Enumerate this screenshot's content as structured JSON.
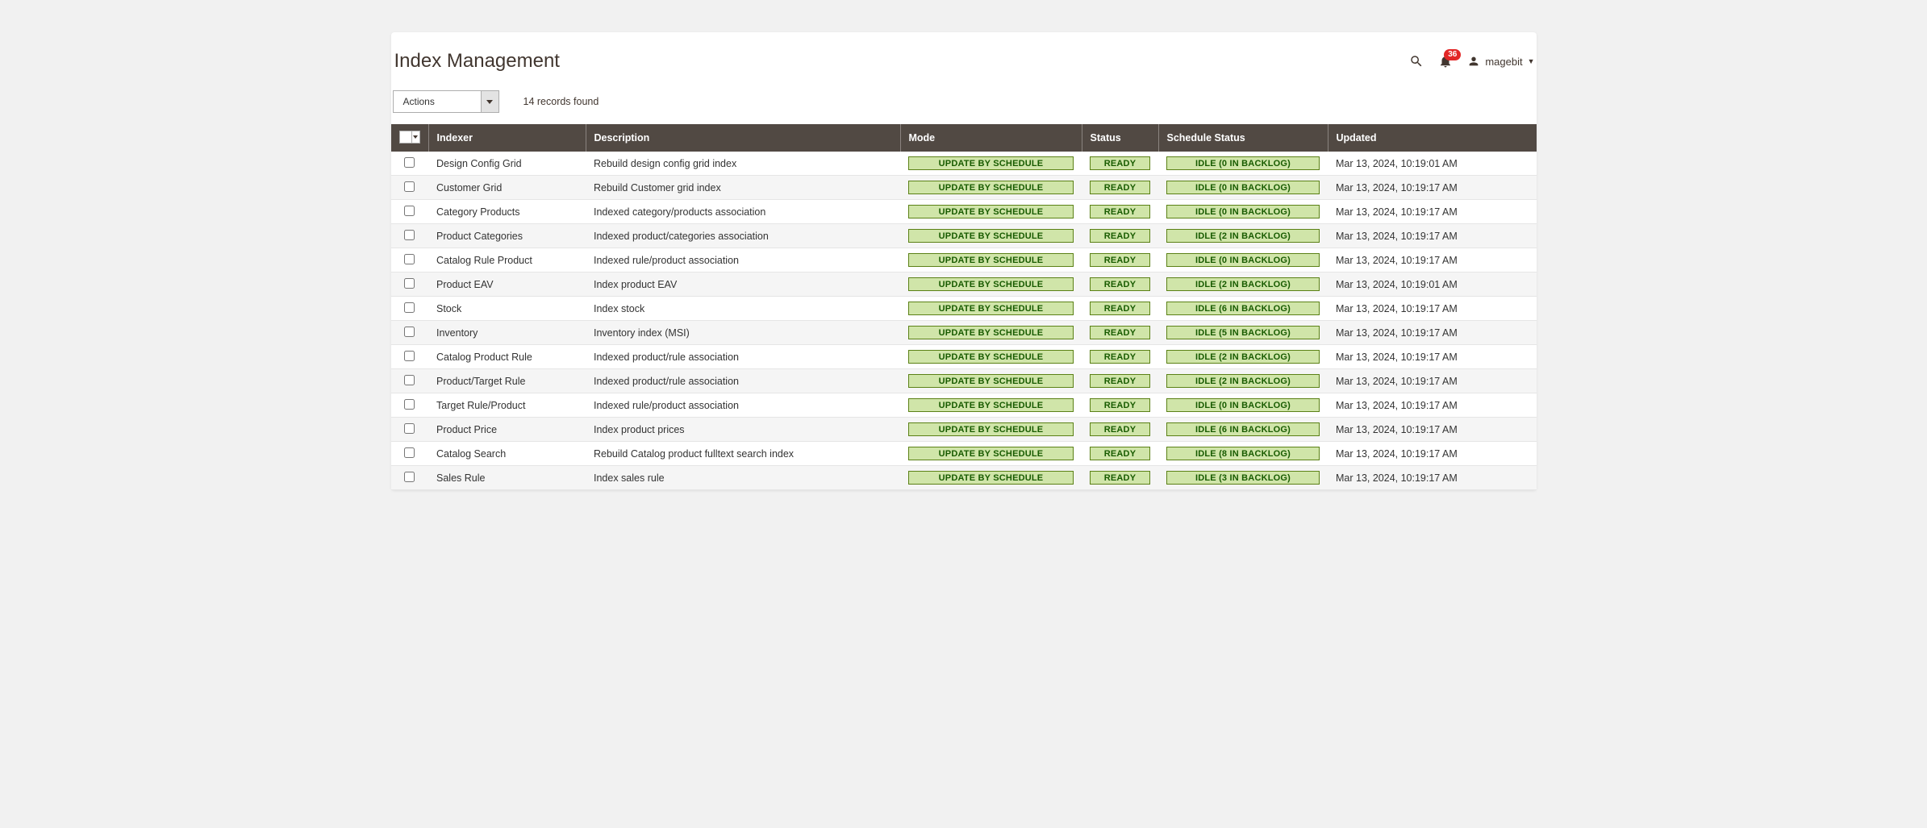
{
  "page_title": "Index Management",
  "notifications_count": "36",
  "user_name": "magebit",
  "actions_label": "Actions",
  "records_found": "14 records found",
  "columns": {
    "indexer": "Indexer",
    "description": "Description",
    "mode": "Mode",
    "status": "Status",
    "schedule_status": "Schedule Status",
    "updated": "Updated"
  },
  "rows": [
    {
      "indexer": "Design Config Grid",
      "description": "Rebuild design config grid index",
      "mode": "UPDATE BY SCHEDULE",
      "status": "READY",
      "schedule": "IDLE (0 IN BACKLOG)",
      "updated": "Mar 13, 2024, 10:19:01 AM"
    },
    {
      "indexer": "Customer Grid",
      "description": "Rebuild Customer grid index",
      "mode": "UPDATE BY SCHEDULE",
      "status": "READY",
      "schedule": "IDLE (0 IN BACKLOG)",
      "updated": "Mar 13, 2024, 10:19:17 AM"
    },
    {
      "indexer": "Category Products",
      "description": "Indexed category/products association",
      "mode": "UPDATE BY SCHEDULE",
      "status": "READY",
      "schedule": "IDLE (0 IN BACKLOG)",
      "updated": "Mar 13, 2024, 10:19:17 AM"
    },
    {
      "indexer": "Product Categories",
      "description": "Indexed product/categories association",
      "mode": "UPDATE BY SCHEDULE",
      "status": "READY",
      "schedule": "IDLE (2 IN BACKLOG)",
      "updated": "Mar 13, 2024, 10:19:17 AM"
    },
    {
      "indexer": "Catalog Rule Product",
      "description": "Indexed rule/product association",
      "mode": "UPDATE BY SCHEDULE",
      "status": "READY",
      "schedule": "IDLE (0 IN BACKLOG)",
      "updated": "Mar 13, 2024, 10:19:17 AM"
    },
    {
      "indexer": "Product EAV",
      "description": "Index product EAV",
      "mode": "UPDATE BY SCHEDULE",
      "status": "READY",
      "schedule": "IDLE (2 IN BACKLOG)",
      "updated": "Mar 13, 2024, 10:19:01 AM"
    },
    {
      "indexer": "Stock",
      "description": "Index stock",
      "mode": "UPDATE BY SCHEDULE",
      "status": "READY",
      "schedule": "IDLE (6 IN BACKLOG)",
      "updated": "Mar 13, 2024, 10:19:17 AM"
    },
    {
      "indexer": "Inventory",
      "description": "Inventory index (MSI)",
      "mode": "UPDATE BY SCHEDULE",
      "status": "READY",
      "schedule": "IDLE (5 IN BACKLOG)",
      "updated": "Mar 13, 2024, 10:19:17 AM"
    },
    {
      "indexer": "Catalog Product Rule",
      "description": "Indexed product/rule association",
      "mode": "UPDATE BY SCHEDULE",
      "status": "READY",
      "schedule": "IDLE (2 IN BACKLOG)",
      "updated": "Mar 13, 2024, 10:19:17 AM"
    },
    {
      "indexer": "Product/Target Rule",
      "description": "Indexed product/rule association",
      "mode": "UPDATE BY SCHEDULE",
      "status": "READY",
      "schedule": "IDLE (2 IN BACKLOG)",
      "updated": "Mar 13, 2024, 10:19:17 AM"
    },
    {
      "indexer": "Target Rule/Product",
      "description": "Indexed rule/product association",
      "mode": "UPDATE BY SCHEDULE",
      "status": "READY",
      "schedule": "IDLE (0 IN BACKLOG)",
      "updated": "Mar 13, 2024, 10:19:17 AM"
    },
    {
      "indexer": "Product Price",
      "description": "Index product prices",
      "mode": "UPDATE BY SCHEDULE",
      "status": "READY",
      "schedule": "IDLE (6 IN BACKLOG)",
      "updated": "Mar 13, 2024, 10:19:17 AM"
    },
    {
      "indexer": "Catalog Search",
      "description": "Rebuild Catalog product fulltext search index",
      "mode": "UPDATE BY SCHEDULE",
      "status": "READY",
      "schedule": "IDLE (8 IN BACKLOG)",
      "updated": "Mar 13, 2024, 10:19:17 AM"
    },
    {
      "indexer": "Sales Rule",
      "description": "Index sales rule",
      "mode": "UPDATE BY SCHEDULE",
      "status": "READY",
      "schedule": "IDLE (3 IN BACKLOG)",
      "updated": "Mar 13, 2024, 10:19:17 AM"
    }
  ]
}
